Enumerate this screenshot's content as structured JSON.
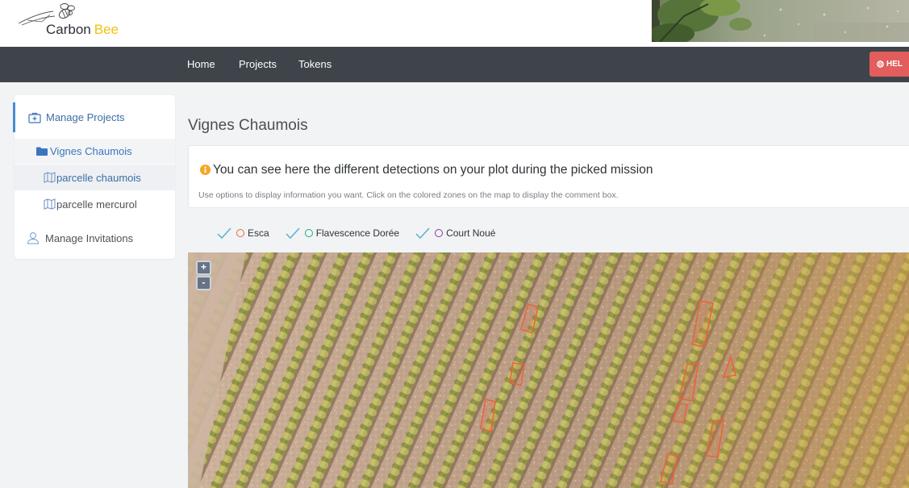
{
  "brand": {
    "name_part1": "Carbon",
    "name_part2": "Bee",
    "logo_icon": "bee-logo-icon",
    "accent_color": "#f4c20d"
  },
  "header_banner": {
    "icon": "vine-leaves-photo"
  },
  "nav": {
    "background": "#3e444a",
    "items": [
      {
        "label": "Home"
      },
      {
        "label": "Projects"
      },
      {
        "label": "Tokens"
      }
    ],
    "help": {
      "label": "HEL",
      "icon": "lifebuoy-icon",
      "color": "#e35d5d"
    }
  },
  "sidebar": {
    "manage_projects": {
      "label": "Manage Projects",
      "icon": "briefcase-icon",
      "active": true
    },
    "projects": [
      {
        "label": "Vignes Chaumois",
        "icon": "folder-icon",
        "plots": [
          {
            "label": "parcelle chaumois",
            "icon": "map-icon",
            "selected": true
          },
          {
            "label": "parcelle mercurol",
            "icon": "map-icon",
            "selected": false
          }
        ]
      }
    ],
    "manage_invitations": {
      "label": "Manage Invitations",
      "icon": "user-icon"
    }
  },
  "page_title": "Vignes Chaumois",
  "info": {
    "icon": "info-circle-icon",
    "headline": "You can see here the different detections on your plot during the picked mission",
    "subtext": "Use options to display information you want. Click on the colored zones on the map to display the comment box."
  },
  "filters": [
    {
      "label": "Esca",
      "checked": true,
      "color": "#e8643c"
    },
    {
      "label": "Flavescence Dorée",
      "checked": true,
      "color": "#2aa68a"
    },
    {
      "label": "Court Noué",
      "checked": true,
      "color": "#92339e"
    }
  ],
  "map": {
    "zoom_in": "+",
    "zoom_out": "-",
    "detection_color": "#e8643c"
  },
  "colors": {
    "accent": "#3a76bd",
    "check": "#5ab0d6"
  }
}
